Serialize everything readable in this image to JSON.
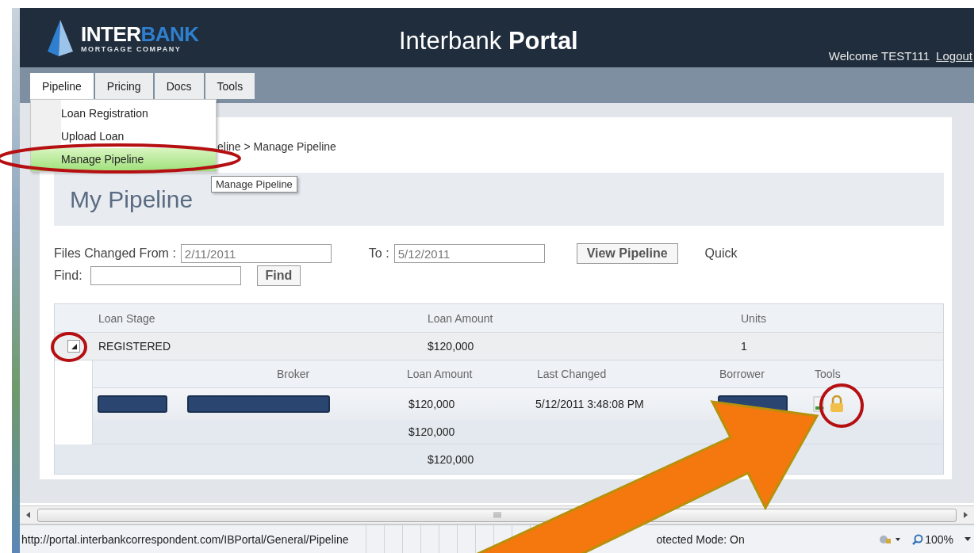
{
  "header": {
    "logo_primary": "INTER",
    "logo_accent": "BANK",
    "logo_sub": "MORTGAGE COMPANY",
    "title_regular": "Interbank",
    "title_bold": "Portal",
    "welcome": "Welcome TEST111",
    "logout": "Logout"
  },
  "menu": [
    {
      "label": "Pipeline",
      "selected": true
    },
    {
      "label": "Pricing",
      "selected": false
    },
    {
      "label": "Docs",
      "selected": false
    },
    {
      "label": "Tools",
      "selected": false
    }
  ],
  "dropdown": {
    "items": [
      {
        "label": "Loan Registration",
        "selected": false
      },
      {
        "label": "Upload Loan",
        "selected": false
      },
      {
        "label": "Manage Pipeline",
        "selected": true
      }
    ],
    "tooltip": "Manage Pipeline"
  },
  "breadcrumb": "eline > Manage Pipeline",
  "heading": "My Pipeline",
  "filters": {
    "from_label": "Files Changed From :",
    "from_value": "2/11/2011",
    "to_label": "To :",
    "to_value": "5/12/2011",
    "view_button": "View Pipeline",
    "quick_label": "Quick",
    "find_label": "Find:",
    "find_button": "Find"
  },
  "table": {
    "columns": [
      "Loan Stage",
      "Loan Amount",
      "Units"
    ],
    "group": {
      "expanded": true,
      "cells": [
        "REGISTERED",
        "$120,000",
        "1"
      ]
    },
    "detail": {
      "columns": [
        "",
        "Broker",
        "Loan Amount",
        "Last Changed",
        "Borrower",
        "Tools"
      ],
      "rows": [
        {
          "cells": [
            {
              "kind": "redacted"
            },
            {
              "kind": "redacted"
            },
            {
              "kind": "text",
              "text": "$120,000"
            },
            {
              "kind": "text",
              "text": "5/12/2011 3:48:08 PM"
            },
            {
              "kind": "redacted"
            },
            {
              "kind": "tools"
            }
          ]
        }
      ],
      "subtotal": "$120,000"
    },
    "total": "$120,000"
  },
  "status_bar": {
    "url": "http://portal.interbankcorrespondent.com/IBPortal/General/Pipeline",
    "mode": "otected Mode: On",
    "zoom": "100%"
  },
  "annotations": [
    {
      "kind": "ellipse"
    },
    {
      "kind": "ellipse"
    },
    {
      "kind": "ellipse"
    },
    {
      "kind": "arrow"
    }
  ]
}
